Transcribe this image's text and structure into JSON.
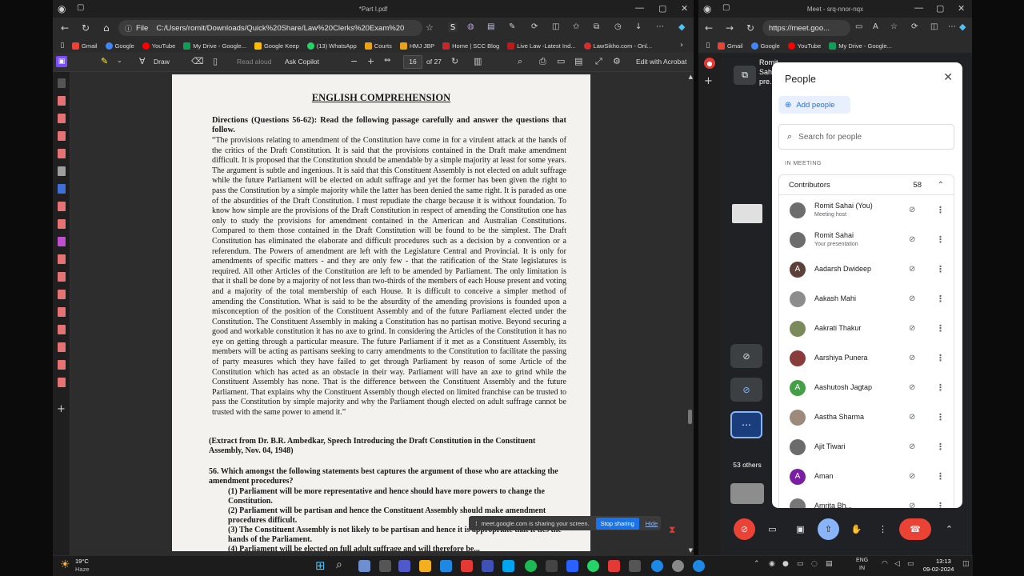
{
  "pdf_browser": {
    "tab_title": "*Part I.pdf",
    "file_label": "File",
    "url": "C:/Users/romit/Downloads/Quick%20Share/Law%20Clerks%20Exam%202024/Part%...",
    "bookmarks": [
      {
        "label": "Gmail",
        "color": "#ea4335"
      },
      {
        "label": "Google",
        "color": "#4285f4"
      },
      {
        "label": "YouTube",
        "color": "#ff0000"
      },
      {
        "label": "My Drive - Google...",
        "color": "#0f9d58"
      },
      {
        "label": "Google Keep",
        "color": "#fbbc04"
      },
      {
        "label": "(13) WhatsApp",
        "color": "#25d366"
      },
      {
        "label": "Courts",
        "color": "#e8a317"
      },
      {
        "label": "HMJ JBP",
        "color": "#e8a317"
      },
      {
        "label": "Home | SCC Blog",
        "color": "#c62828"
      },
      {
        "label": "Live Law -Latest Ind...",
        "color": "#b71c1c"
      },
      {
        "label": "LawSikho.com - Onl...",
        "color": "#d32f2f"
      }
    ],
    "toolbar": {
      "draw": "Draw",
      "read_aloud": "Read aloud",
      "ask_copilot": "Ask Copilot",
      "page_current": "16",
      "page_total": "of 27",
      "edit_acrobat": "Edit with Acrobat"
    },
    "document": {
      "title": "ENGLISH COMPREHENSION",
      "directions": "Directions (Questions 56-62): Read the following passage carefully and answer the questions that follow.",
      "passage": "“The provisions relating to amendment of the Constitution have come in for a virulent attack at the hands of the critics of the Draft Constitution. It is said that the provisions contained in the Draft make amendment difficult. It is proposed that the Constitution should be amendable by a simple majority at least for some years. The argument is subtle and ingenious. It is said that this Constituent Assembly is not elected on adult suffrage while the future Parliament will be elected on adult suffrage and yet the former has been given the right to pass the Constitution by a simple majority while the latter has been denied the same right. It is paraded as one of the absurdities of the Draft Constitution. I must repudiate the charge because it is without foundation. To know how simple are the provisions of the Draft Constitution in respect of amending the Constitution one has only to study the provisions for amendment contained in the American and Australian Constitutions. Compared to them those contained in the Draft Constitution will be found to be the simplest. The Draft Constitution has eliminated the elaborate and difficult procedures such as a decision by a convention or a referendum. The Powers of amendment are left with the Legislature Central and Provincial. It is only for amendments of specific matters - and they are only few - that the ratification of the State legislatures is required. All other Articles of the Constitution are left to be amended by Parliament. The only limitation is that it shall be done by a majority of not less than two-thirds of the members of each House present and voting and a majority of the total membership of each House. It is difficult to conceive a simpler method of amending the Constitution. What is said to be the absurdity of the amending provisions is founded upon a misconception of the position of the Constituent Assembly and of the future Parliament elected under the Constitution. The Constituent Assembly in making a Constitution has no partisan motive. Beyond securing a good and workable constitution it has no axe to grind. In considering the Articles of the Constitution it has no eye on getting through a particular measure. The future Parliament if it met as a Constituent Assembly, its members will be acting as partisans seeking to carry amendments to the Constitution to facilitate the passing of party measures which they have failed to get through Parliament by reason of some Article of the Constitution which has acted as an obstacle in their way. Parliament will have an axe to grind while the Constituent Assembly has none. That is the difference between the Constituent Assembly and the future Parliament. That explains why the Constituent Assembly though elected on limited franchise can be trusted to pass the Constitution by simple majority and why the Parliament though elected on adult suffrage cannot be trusted with the same power to amend it.”",
      "extract": "(Extract from Dr. B.R. Ambedkar, Speech Introducing the Draft Constitution in the Constituent Assembly, Nov. 04, 1948)",
      "question": "56. Which amongst the following statements best captures the argument of those who are attacking the amendment procedures?",
      "options": [
        "(1) Parliament will be more representative and hence should have more powers to change the Constitution.",
        "(2) Parliament will be partisan and hence the Constituent Assembly should make amendment procedures difficult.",
        "(3) The Constituent Assembly is not likely to be partisan and hence it is appropriate that it ties the hands of the Parliament.",
        "(4) Parliament will be elected on full adult suffrage and will therefore be..."
      ]
    },
    "share_notice": {
      "text": "meet.google.com is sharing your screen.",
      "stop": "Stop sharing",
      "hide": "Hide"
    }
  },
  "meet_browser": {
    "tab_title": "Meet - srq-nnor-nqx",
    "url": "https://meet.goo...",
    "bookmarks": [
      "Gmail",
      "Google",
      "YouTube",
      "My Drive - Google..."
    ],
    "presenter_label": "Romit Sah... pre...",
    "others_label": "53 others",
    "people": {
      "title": "People",
      "add_people": "Add people",
      "search_placeholder": "Search for people",
      "in_meeting": "IN MEETING",
      "contributors_label": "Contributors",
      "contributors_count": "58",
      "list": [
        {
          "name": "Romit Sahai (You)",
          "role": "Meeting host",
          "avatar": "photo",
          "color": "#6d6d6d"
        },
        {
          "name": "Romit Sahai",
          "role": "Your presentation",
          "avatar": "photo",
          "color": "#6d6d6d"
        },
        {
          "name": "Aadarsh Dwideep",
          "role": "",
          "avatar": "A",
          "color": "#5d4037"
        },
        {
          "name": "Aakash Mahi",
          "role": "",
          "avatar": "photo",
          "color": "#8d8d8d"
        },
        {
          "name": "Aakrati Thakur",
          "role": "",
          "avatar": "photo",
          "color": "#7b8a5b"
        },
        {
          "name": "Aarshiya Punera",
          "role": "",
          "avatar": "photo",
          "color": "#8a3b3b"
        },
        {
          "name": "Aashutosh Jagtap",
          "role": "",
          "avatar": "A",
          "color": "#43a047"
        },
        {
          "name": "Aastha Sharma",
          "role": "",
          "avatar": "photo",
          "color": "#9e8a7a"
        },
        {
          "name": "Ajit Tiwari",
          "role": "",
          "avatar": "photo",
          "color": "#6b6b6b"
        },
        {
          "name": "Aman",
          "role": "",
          "avatar": "A",
          "color": "#7b1fa2"
        },
        {
          "name": "Amrita Bh...",
          "role": "",
          "avatar": "photo",
          "color": "#777"
        }
      ]
    }
  },
  "taskbar": {
    "weather_temp": "19°C",
    "weather_desc": "Haze",
    "lang_top": "ENG",
    "lang_bottom": "IN",
    "time": "13:13",
    "date": "09-02-2024"
  }
}
